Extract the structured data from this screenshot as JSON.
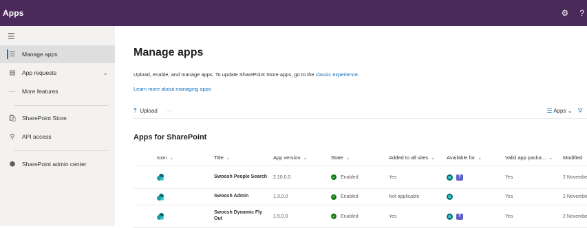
{
  "topbar": {
    "title": "Apps",
    "settings_icon": "gear-icon",
    "help_label": "?"
  },
  "sidebar": {
    "menu_icon": "hamburger-icon",
    "items": [
      {
        "label": "Manage apps",
        "icon": "list-icon",
        "active": true
      },
      {
        "label": "App requests",
        "icon": "document-icon",
        "expandable": true
      },
      {
        "label": "More features",
        "icon": "more-icon"
      },
      {
        "label": "SharePoint Store",
        "icon": "store-icon"
      },
      {
        "label": "API access",
        "icon": "key-icon"
      },
      {
        "label": "SharePoint admin center",
        "icon": "sharepoint-icon"
      }
    ]
  },
  "main": {
    "title": "Manage apps",
    "description": "Upload, enable, and manage apps. To update SharePoint Store apps, go to the ",
    "description_link": "classic experience",
    "description_end": ".",
    "learn_more": "Learn more about managing apps",
    "commands": {
      "upload": "Upload",
      "more": "···",
      "view": "Apps"
    },
    "section_title": "Apps for SharePoint",
    "columns": [
      "Icon",
      "Title",
      "App version",
      "State",
      "Added to all sites",
      "Available for",
      "Valid app packa...",
      "Modified"
    ],
    "rows": [
      {
        "title": "Swoosh People Search",
        "version": "2.10.0.0",
        "state": "Enabled",
        "added": "Yes",
        "teams": true,
        "valid": "Yes",
        "modified": "2 Novembe"
      },
      {
        "title": "Swoosh Admin",
        "version": "1.3.0.0",
        "state": "Enabled",
        "added": "Not applicable",
        "teams": false,
        "valid": "Yes",
        "modified": "2 Novembe"
      },
      {
        "title": "Swoosh Dynamic Fly Out",
        "version": "1.5.0.0",
        "state": "Enabled",
        "added": "Yes",
        "teams": true,
        "valid": "Yes",
        "modified": "2 Novembe"
      }
    ]
  },
  "colors": {
    "suite_bar": "#4b2a5b",
    "accent": "#0078d4",
    "enabled": "#107c10"
  }
}
